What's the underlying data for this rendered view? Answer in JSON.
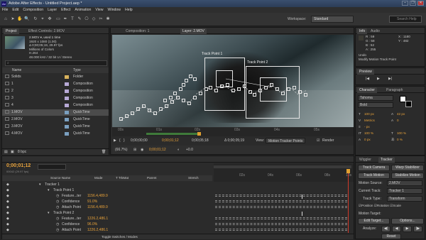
{
  "window": {
    "title": "Adobe After Effects - Untitled Project.aep *",
    "logo": "Ae",
    "buttons": [
      "–",
      "❐",
      "✕"
    ]
  },
  "menu": [
    "File",
    "Edit",
    "Composition",
    "Layer",
    "Effect",
    "Animation",
    "View",
    "Window",
    "Help"
  ],
  "toolbar": {
    "workspace_label": "Workspace:",
    "workspace_value": "Standard",
    "search_placeholder": "Search Help"
  },
  "project": {
    "tabs": [
      "Project",
      "Effect Controls: 2.MOV"
    ],
    "preview_name": "2.MOV ▾, used 1 time",
    "preview_info": [
      "1920 x 1080 (1.00)",
      "Δ 0;00;05;19, 29.97 fps",
      "Millions of Colors",
      "H.264",
      "48.000 kHz / 32 bit U / Stereo"
    ],
    "search_placeholder": "⌕",
    "col_name": "Name",
    "col_type": "Type",
    "items": [
      {
        "name": "Solids",
        "type": "Folder",
        "color": "#d8b25c"
      },
      {
        "name": "1",
        "type": "Composition",
        "color": "#b7a9d6"
      },
      {
        "name": "2",
        "type": "Composition",
        "color": "#b7a9d6"
      },
      {
        "name": "3",
        "type": "Composition",
        "color": "#b7a9d6"
      },
      {
        "name": "4",
        "type": "Composition",
        "color": "#b7a9d6"
      },
      {
        "name": "1.MOV",
        "type": "QuickTime",
        "color": "#7a9fbf"
      },
      {
        "name": "2.MOV",
        "type": "QuickTime",
        "color": "#7a9fbf"
      },
      {
        "name": "3.MOV",
        "type": "QuickTime",
        "color": "#7a9fbf"
      },
      {
        "name": "4.MOV",
        "type": "QuickTime",
        "color": "#7a9fbf"
      }
    ],
    "footer": "8 bpc"
  },
  "viewer": {
    "tabs": [
      "Composition: 1",
      "Layer: 2.MOV"
    ],
    "track_labels": [
      "Track Point 1",
      "Track Point 2"
    ],
    "ruler": [
      "00s",
      "01s",
      "02s",
      "03s",
      "04s",
      "05s"
    ],
    "timecode": "0;00;01;12",
    "in_time": "0;00;00;00",
    "out_time": "0;00;05;18",
    "duration": "Δ 0;00;05;19",
    "view_label": "View:",
    "view_value": "Motion Tracker Points",
    "render_label": "Render",
    "zoom": "(66.7%)",
    "bottom_time": "0;00;01;12",
    "exposure": "+0.0"
  },
  "info": {
    "tabs": [
      "Info",
      "Audio"
    ],
    "rgba": [
      "R : 59",
      "G : 58",
      "B : 52",
      "A : 255"
    ],
    "xy": [
      "X : 1180",
      "Y : 482"
    ],
    "undo": "Undo",
    "undo_action": "Modify Motion Track Point"
  },
  "preview": {
    "tab": "Preview"
  },
  "character": {
    "tabs": [
      "Character",
      "Paragraph"
    ],
    "font": "Tahoma",
    "style": "Bold",
    "size": "100 px",
    "leading": "42 px",
    "kerning": "Metrics",
    "tracking": "0",
    "stroke_width": "- px",
    "vscale": "100 %",
    "hscale": "100 %",
    "baseline": "0 px",
    "tsume": "0 %"
  },
  "tracker": {
    "tabs": [
      "Wiggler",
      "Tracker"
    ],
    "buttons": [
      "Track Camera",
      "Warp Stabilizer",
      "Track Motion",
      "Stabilize Motion"
    ],
    "motion_source_label": "Motion Source:",
    "motion_source": "2.MOV",
    "current_track_label": "Current Track:",
    "current_track": "Tracker 1",
    "track_type_label": "Track Type:",
    "track_type": "Transform",
    "checks": [
      "Position",
      "Rotation",
      "Scale"
    ],
    "motion_target_label": "Motion Target:",
    "edit_target": "Edit Target...",
    "options": "Options...",
    "analyze_label": "Analyze:",
    "analyze_buttons": [
      "◀|",
      "◀",
      "▶",
      "|▶"
    ],
    "reset": "Reset"
  },
  "timeline": {
    "timecode": "0;00;01;12",
    "frame_info": "00042 (29.97 fps)",
    "cols": [
      "Source Name",
      "Mode",
      "T TrkMat",
      "Parent",
      "Stretch"
    ],
    "rows": [
      {
        "indent": 0,
        "name": "Tracker 1",
        "val": "",
        "bars": false
      },
      {
        "indent": 1,
        "name": "Track Point 1",
        "val": "",
        "bars": false
      },
      {
        "indent": 2,
        "name": "Feature...ter",
        "val": "1156.4,489.9",
        "bars": true
      },
      {
        "indent": 2,
        "name": "Confidence",
        "val": "91.0%",
        "bars": true
      },
      {
        "indent": 2,
        "name": "Attach Point",
        "val": "1156.4,489.9",
        "bars": true
      },
      {
        "indent": 1,
        "name": "Track Point 2",
        "val": "",
        "bars": false
      },
      {
        "indent": 2,
        "name": "Feature...ter",
        "val": "1226.2,486.1",
        "bars": true
      },
      {
        "indent": 2,
        "name": "Confidence",
        "val": "96.0%",
        "bars": true
      },
      {
        "indent": 2,
        "name": "Attach Point",
        "val": "1226.2,486.1",
        "bars": true
      }
    ],
    "ruler": [
      "02s",
      "04s",
      "06s",
      "08s",
      "10s"
    ],
    "footer": "Toggle Switches / Modes"
  }
}
